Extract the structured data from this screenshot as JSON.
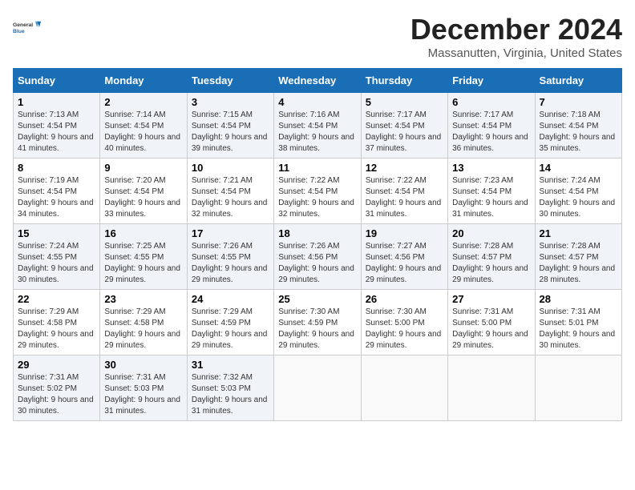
{
  "logo": {
    "line1": "General",
    "line2": "Blue"
  },
  "title": "December 2024",
  "subtitle": "Massanutten, Virginia, United States",
  "days_of_week": [
    "Sunday",
    "Monday",
    "Tuesday",
    "Wednesday",
    "Thursday",
    "Friday",
    "Saturday"
  ],
  "weeks": [
    [
      {
        "day": "1",
        "sunrise": "7:13 AM",
        "sunset": "4:54 PM",
        "daylight": "9 hours and 41 minutes."
      },
      {
        "day": "2",
        "sunrise": "7:14 AM",
        "sunset": "4:54 PM",
        "daylight": "9 hours and 40 minutes."
      },
      {
        "day": "3",
        "sunrise": "7:15 AM",
        "sunset": "4:54 PM",
        "daylight": "9 hours and 39 minutes."
      },
      {
        "day": "4",
        "sunrise": "7:16 AM",
        "sunset": "4:54 PM",
        "daylight": "9 hours and 38 minutes."
      },
      {
        "day": "5",
        "sunrise": "7:17 AM",
        "sunset": "4:54 PM",
        "daylight": "9 hours and 37 minutes."
      },
      {
        "day": "6",
        "sunrise": "7:17 AM",
        "sunset": "4:54 PM",
        "daylight": "9 hours and 36 minutes."
      },
      {
        "day": "7",
        "sunrise": "7:18 AM",
        "sunset": "4:54 PM",
        "daylight": "9 hours and 35 minutes."
      }
    ],
    [
      {
        "day": "8",
        "sunrise": "7:19 AM",
        "sunset": "4:54 PM",
        "daylight": "9 hours and 34 minutes."
      },
      {
        "day": "9",
        "sunrise": "7:20 AM",
        "sunset": "4:54 PM",
        "daylight": "9 hours and 33 minutes."
      },
      {
        "day": "10",
        "sunrise": "7:21 AM",
        "sunset": "4:54 PM",
        "daylight": "9 hours and 32 minutes."
      },
      {
        "day": "11",
        "sunrise": "7:22 AM",
        "sunset": "4:54 PM",
        "daylight": "9 hours and 32 minutes."
      },
      {
        "day": "12",
        "sunrise": "7:22 AM",
        "sunset": "4:54 PM",
        "daylight": "9 hours and 31 minutes."
      },
      {
        "day": "13",
        "sunrise": "7:23 AM",
        "sunset": "4:54 PM",
        "daylight": "9 hours and 31 minutes."
      },
      {
        "day": "14",
        "sunrise": "7:24 AM",
        "sunset": "4:54 PM",
        "daylight": "9 hours and 30 minutes."
      }
    ],
    [
      {
        "day": "15",
        "sunrise": "7:24 AM",
        "sunset": "4:55 PM",
        "daylight": "9 hours and 30 minutes."
      },
      {
        "day": "16",
        "sunrise": "7:25 AM",
        "sunset": "4:55 PM",
        "daylight": "9 hours and 29 minutes."
      },
      {
        "day": "17",
        "sunrise": "7:26 AM",
        "sunset": "4:55 PM",
        "daylight": "9 hours and 29 minutes."
      },
      {
        "day": "18",
        "sunrise": "7:26 AM",
        "sunset": "4:56 PM",
        "daylight": "9 hours and 29 minutes."
      },
      {
        "day": "19",
        "sunrise": "7:27 AM",
        "sunset": "4:56 PM",
        "daylight": "9 hours and 29 minutes."
      },
      {
        "day": "20",
        "sunrise": "7:28 AM",
        "sunset": "4:57 PM",
        "daylight": "9 hours and 29 minutes."
      },
      {
        "day": "21",
        "sunrise": "7:28 AM",
        "sunset": "4:57 PM",
        "daylight": "9 hours and 28 minutes."
      }
    ],
    [
      {
        "day": "22",
        "sunrise": "7:29 AM",
        "sunset": "4:58 PM",
        "daylight": "9 hours and 29 minutes."
      },
      {
        "day": "23",
        "sunrise": "7:29 AM",
        "sunset": "4:58 PM",
        "daylight": "9 hours and 29 minutes."
      },
      {
        "day": "24",
        "sunrise": "7:29 AM",
        "sunset": "4:59 PM",
        "daylight": "9 hours and 29 minutes."
      },
      {
        "day": "25",
        "sunrise": "7:30 AM",
        "sunset": "4:59 PM",
        "daylight": "9 hours and 29 minutes."
      },
      {
        "day": "26",
        "sunrise": "7:30 AM",
        "sunset": "5:00 PM",
        "daylight": "9 hours and 29 minutes."
      },
      {
        "day": "27",
        "sunrise": "7:31 AM",
        "sunset": "5:00 PM",
        "daylight": "9 hours and 29 minutes."
      },
      {
        "day": "28",
        "sunrise": "7:31 AM",
        "sunset": "5:01 PM",
        "daylight": "9 hours and 30 minutes."
      }
    ],
    [
      {
        "day": "29",
        "sunrise": "7:31 AM",
        "sunset": "5:02 PM",
        "daylight": "9 hours and 30 minutes."
      },
      {
        "day": "30",
        "sunrise": "7:31 AM",
        "sunset": "5:03 PM",
        "daylight": "9 hours and 31 minutes."
      },
      {
        "day": "31",
        "sunrise": "7:32 AM",
        "sunset": "5:03 PM",
        "daylight": "9 hours and 31 minutes."
      },
      null,
      null,
      null,
      null
    ]
  ]
}
